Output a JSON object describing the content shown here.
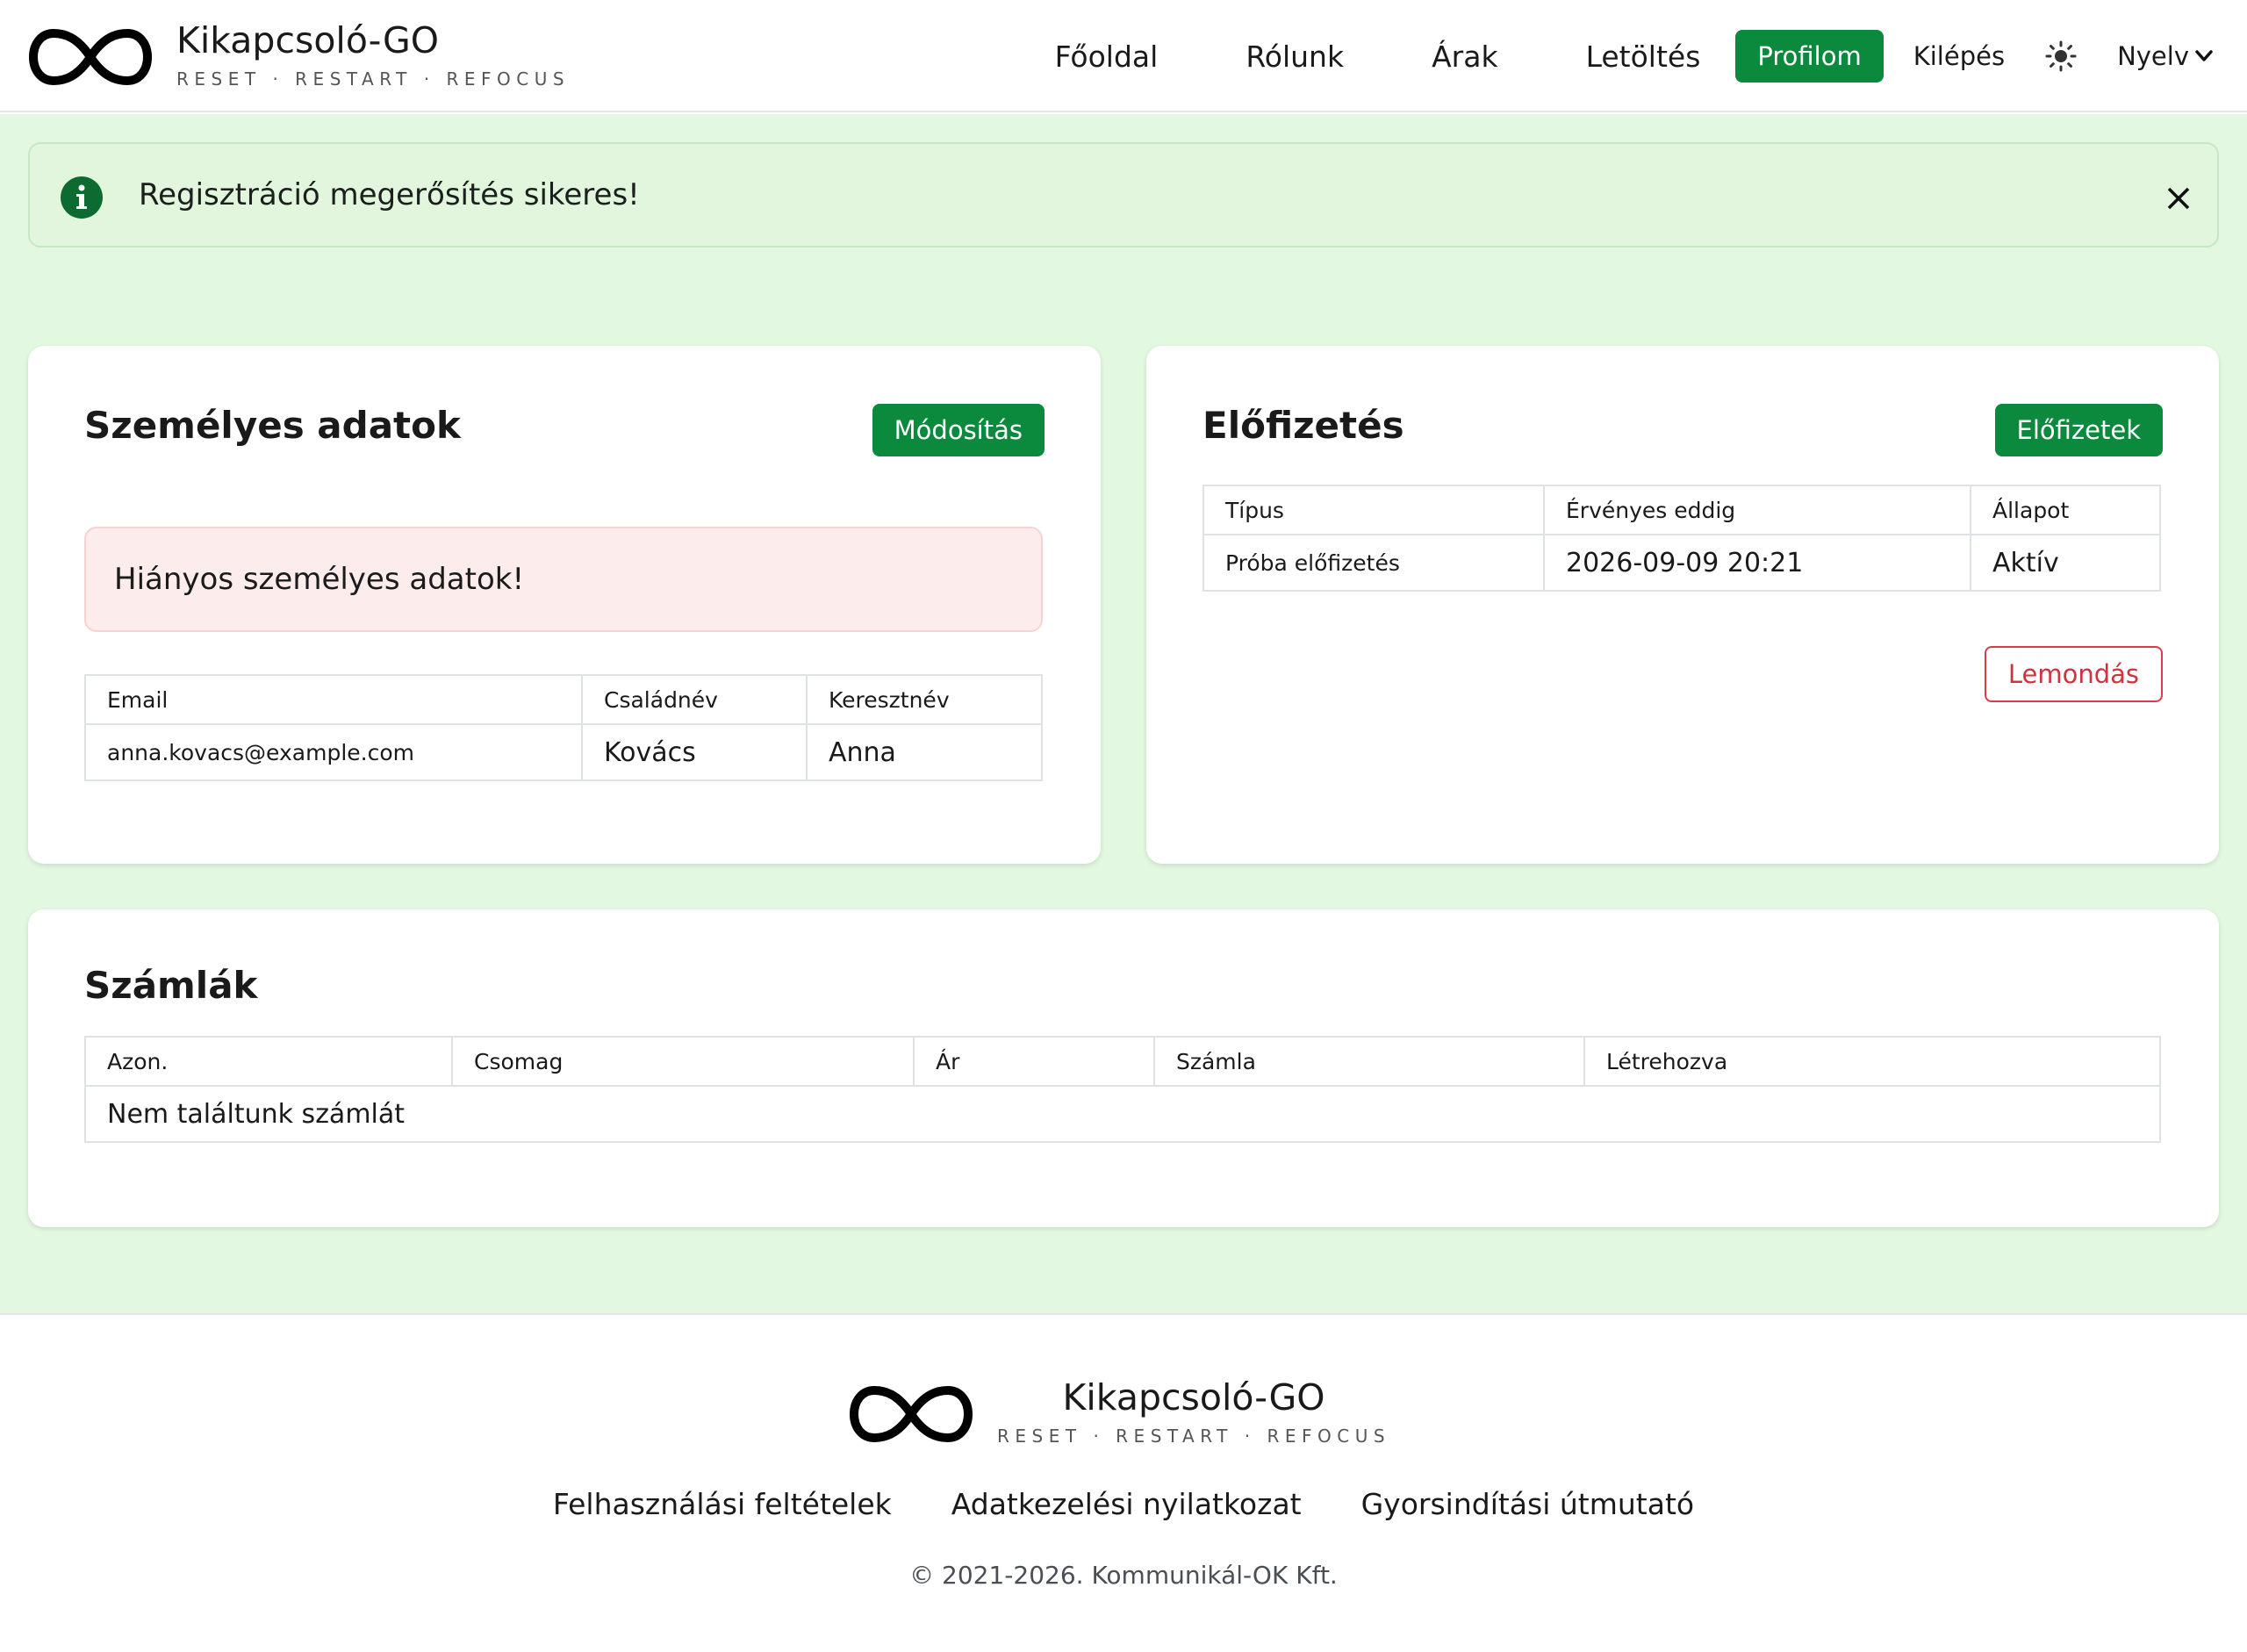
{
  "brand": {
    "name": "Kikapcsoló-GO",
    "tagline": "RESET · RESTART · REFOCUS"
  },
  "nav": {
    "items": [
      "Főoldal",
      "Rólunk",
      "Árak",
      "Letöltés"
    ],
    "profile": "Profilom",
    "logout": "Kilépés",
    "theme_icon": "sun-icon",
    "language": "Nyelv"
  },
  "alert": {
    "message": "Regisztráció megerősítés sikeres!",
    "icon": "info-circle-icon"
  },
  "personal": {
    "title": "Személyes adatok",
    "edit_button": "Módosítás",
    "warning": "Hiányos személyes adatok!",
    "headers": [
      "Email",
      "Családnév",
      "Keresztnév"
    ],
    "row": [
      "anna.kovacs@example.com",
      "Kovács",
      "Anna"
    ]
  },
  "subscription": {
    "title": "Előfizetés",
    "subscribe_button": "Előfizetek",
    "headers": [
      "Típus",
      "Érvényes eddig",
      "Állapot"
    ],
    "row": [
      "Próba előfizetés",
      "2026-09-09 20:21",
      "Aktív"
    ],
    "cancel_button": "Lemondás"
  },
  "invoices": {
    "title": "Számlák",
    "headers": [
      "Azon.",
      "Csomag",
      "Ár",
      "Számla",
      "Létrehozva"
    ],
    "empty": "Nem találtunk számlát"
  },
  "footer": {
    "links": [
      "Felhasználási feltételek",
      "Adatkezelési nyilatkozat",
      "Gyorsindítási útmutató"
    ],
    "copyright": "© 2021-2026. Kommunikál-OK Kft."
  },
  "colors": {
    "accent": "#0b8a3e",
    "main_bg": "#e3f8e1",
    "danger": "#d0323f"
  }
}
